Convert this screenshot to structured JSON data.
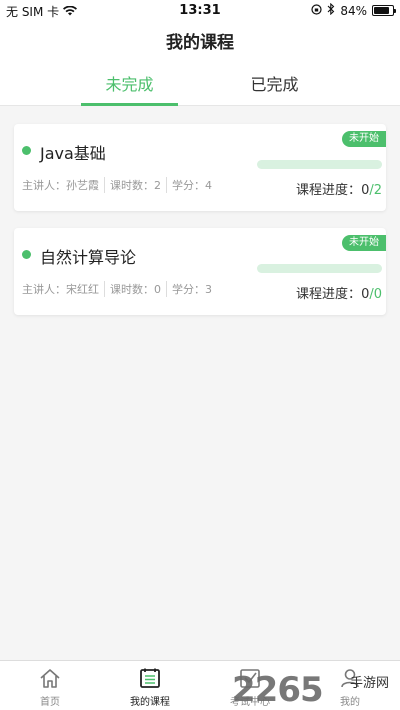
{
  "status_bar": {
    "carrier": "无 SIM 卡",
    "time": "13:31",
    "battery": "84%",
    "battery_level": 0.84
  },
  "header": {
    "title": "我的课程"
  },
  "tabs": [
    {
      "label": "未完成",
      "active": true
    },
    {
      "label": "已完成",
      "active": false
    }
  ],
  "courses": [
    {
      "name": "Java基础",
      "badge": "未开始",
      "lecturer": "主讲人：孙艺霞",
      "hours": "课时数：2",
      "credits": "学分：4",
      "progress_label": "课程进度：",
      "progress_done": "0",
      "progress_total": "/2",
      "progress_fraction": 0
    },
    {
      "name": "自然计算导论",
      "badge": "未开始",
      "lecturer": "主讲人：宋红红",
      "hours": "课时数：0",
      "credits": "学分：3",
      "progress_label": "课程进度：",
      "progress_done": "0",
      "progress_total": "/0",
      "progress_fraction": 0
    }
  ],
  "bottom_nav": [
    {
      "label": "首页",
      "icon": "home-icon"
    },
    {
      "label": "我的课程",
      "icon": "course-list-icon",
      "active": true
    },
    {
      "label": "考试中心",
      "icon": "exam-icon"
    },
    {
      "label": "我的",
      "icon": "profile-icon"
    }
  ],
  "watermark": {
    "number": "2265",
    "text": "手游网"
  },
  "colors": {
    "accent": "#4cbf6c",
    "accent_light": "#d9f1e0"
  }
}
